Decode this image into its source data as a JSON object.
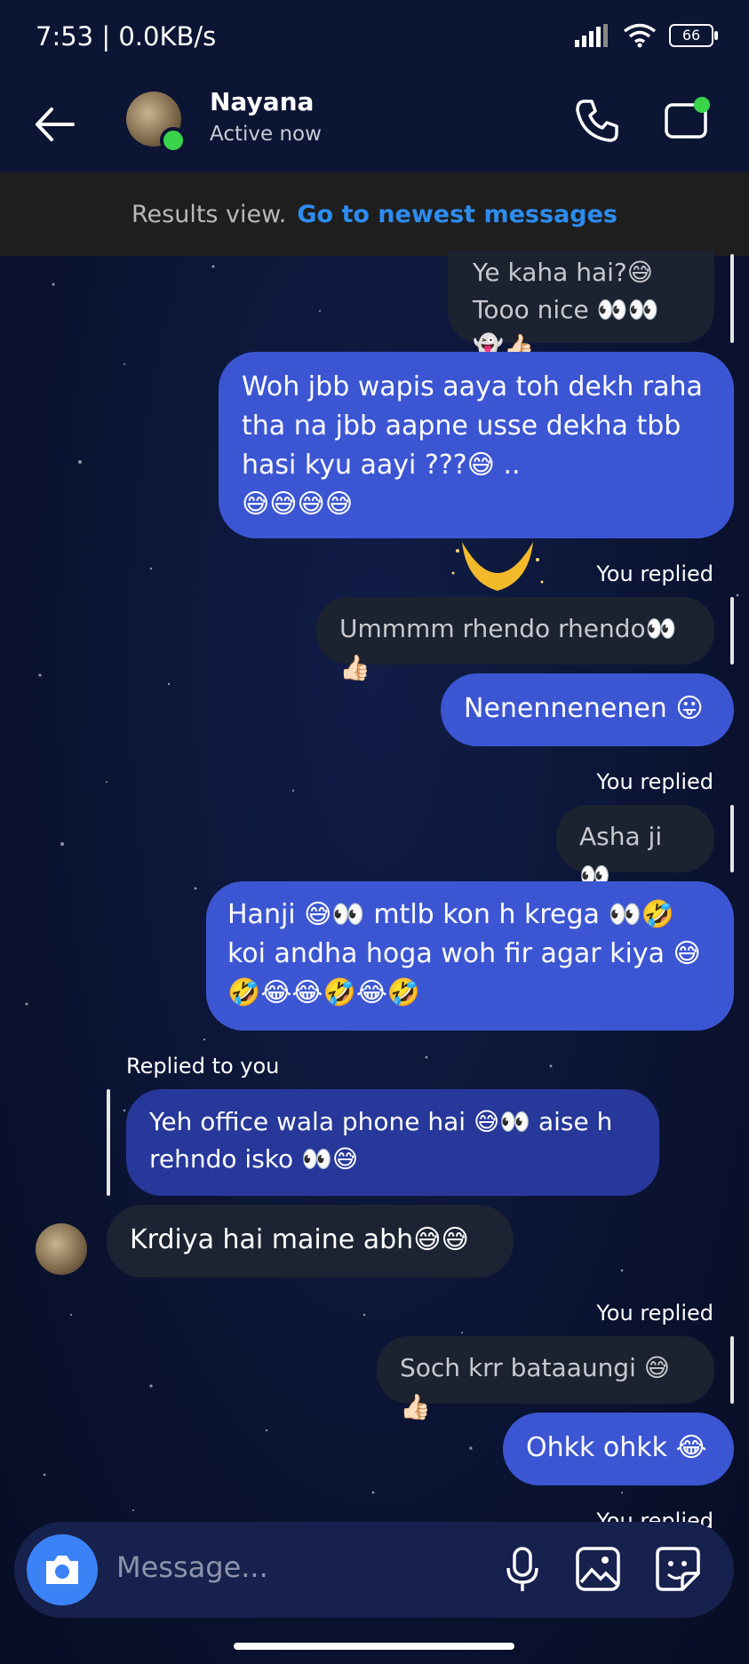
{
  "status_bar": {
    "time": "7:53 | 0.0KB/s",
    "battery": "66"
  },
  "header": {
    "contact_name": "Nayana",
    "presence": "Active now"
  },
  "results_banner": {
    "label": "Results view.",
    "link": "Go to newest messages"
  },
  "messages": {
    "reply1_line1": "Ye kaha hai?😅",
    "reply1_line2": "Tooo nice 👀👀👻👍🏻",
    "msg1_l1": "Woh jbb wapis aaya toh dekh raha",
    "msg1_l2": "tha na jbb aapne usse dekha tbb",
    "msg1_l3": "hasi kyu aayi ???😅 ..",
    "msg1_l4": "😅😅😅😅",
    "you_replied_1": "You replied",
    "reply2": "Ummmm rhendo rhendo👀👍🏻",
    "msg2": "Nenennenenen 😛",
    "you_replied_2": "You replied",
    "reply3": "Asha ji👀",
    "msg3_l1": "Hanji 😅👀 mtlb kon h krega 👀🤣",
    "msg3_l2": "koi andha hoga woh fir agar kiya 😅",
    "msg3_l3": "🤣😂😂🤣😂🤣",
    "replied_to_you": "Replied to you",
    "quoted_l1": "Yeh office wala phone hai 😅👀 aise h",
    "quoted_l2": "rehndo isko 👀😅",
    "incoming1": "Krdiya hai maine abh😅😅",
    "you_replied_3": "You replied",
    "reply4": "Soch krr bataaungi 😅👍🏻",
    "msg4": "Ohkk ohkk 😂",
    "you_replied_4": "You replied"
  },
  "composer": {
    "placeholder": "Message..."
  },
  "colors": {
    "outgoing": "#3c56d3",
    "link": "#2d8cf0",
    "online": "#3ad44b"
  }
}
